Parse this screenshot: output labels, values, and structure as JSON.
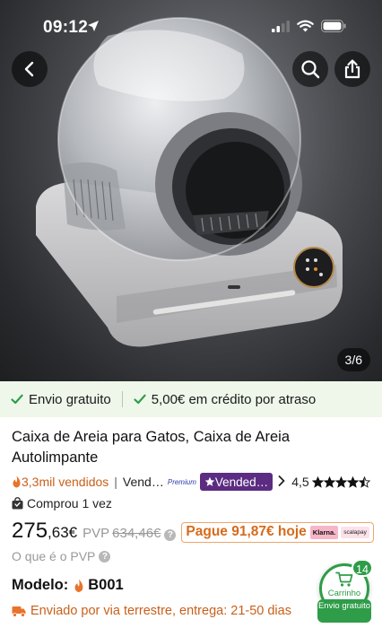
{
  "status_bar": {
    "time": "09:12"
  },
  "gallery": {
    "counter": "3/6"
  },
  "banner": {
    "free_shipping": "Envio gratuito",
    "delay_credit": "5,00€ em crédito por atraso"
  },
  "product": {
    "title": "Caixa de Areia para Gatos, Caixa de Areia Autolimpante",
    "sold": "3,3mil vendidos",
    "seller_1": "Vend…",
    "seller_1_badge": "Premium",
    "star_seller": "Vended…",
    "rating": "4,5",
    "stars": 4.5,
    "bought": "Comprou 1 vez",
    "price_int": "275",
    "price_dec": ",63€",
    "pvp_label": "PVP",
    "pvp_value": "634,46€",
    "pay_today": "Pague 91,87€ hoje",
    "klarna": "Klarna.",
    "scalapay": "scalapay",
    "whats_pvp": "O que é o PVP",
    "model_label": "Modelo:",
    "model_value": "B001",
    "shipping": "Enviado por via terrestre, entrega: 21-50 dias"
  },
  "cart": {
    "count": "14",
    "label": "Carrinho",
    "free_shipping": "Envio gratuito"
  },
  "colors": {
    "accent_orange": "#c8601b",
    "green": "#2e9c48",
    "banner_bg": "#eef7ea",
    "star_seller_bg": "#5b2c82"
  }
}
